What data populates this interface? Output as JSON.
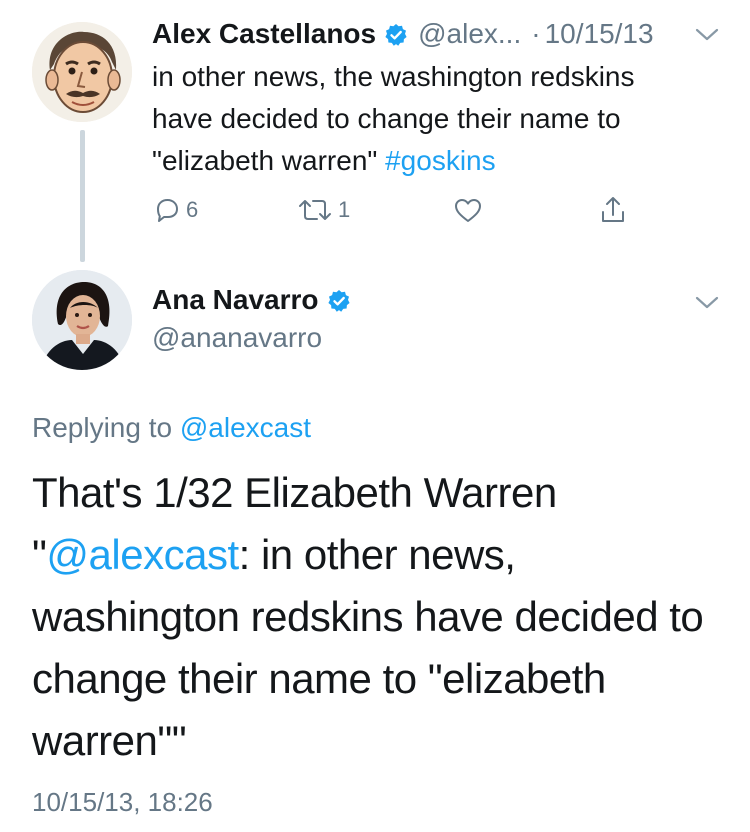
{
  "original_tweet": {
    "author_name": "Alex Castellanos",
    "handle": "@alex...",
    "separator": "·",
    "date": "10/15/13",
    "text_lines": [
      "in other news, the washington redskins",
      "have decided to change their name to",
      "\"elizabeth warren\""
    ],
    "hashtag": "#goskins",
    "actions": {
      "reply_count": "6",
      "retweet_count": "1"
    }
  },
  "reply_tweet": {
    "author_name": "Ana Navarro",
    "handle": "@ananavarro",
    "replying_prefix": "Replying to ",
    "replying_handle": "@alexcast",
    "text_line1": "That's 1/32 Elizabeth Warren",
    "quote_open": "\"",
    "quote_mention": "@alexcast",
    "text_line2_rest": ": in other news,",
    "text_line3": "washington redskins have decided to",
    "text_line4": "change their name to \"elizabeth",
    "text_line5": "warren\"\"",
    "timestamp": "10/15/13, 18:26"
  },
  "colors": {
    "link": "#1da1f2",
    "muted": "#657786",
    "verified": "#1da1f2",
    "thread_line": "#ccd6dd"
  },
  "icons": [
    "verified-badge-icon",
    "chevron-down-icon",
    "reply-icon",
    "retweet-icon",
    "like-heart-icon",
    "share-icon"
  ]
}
